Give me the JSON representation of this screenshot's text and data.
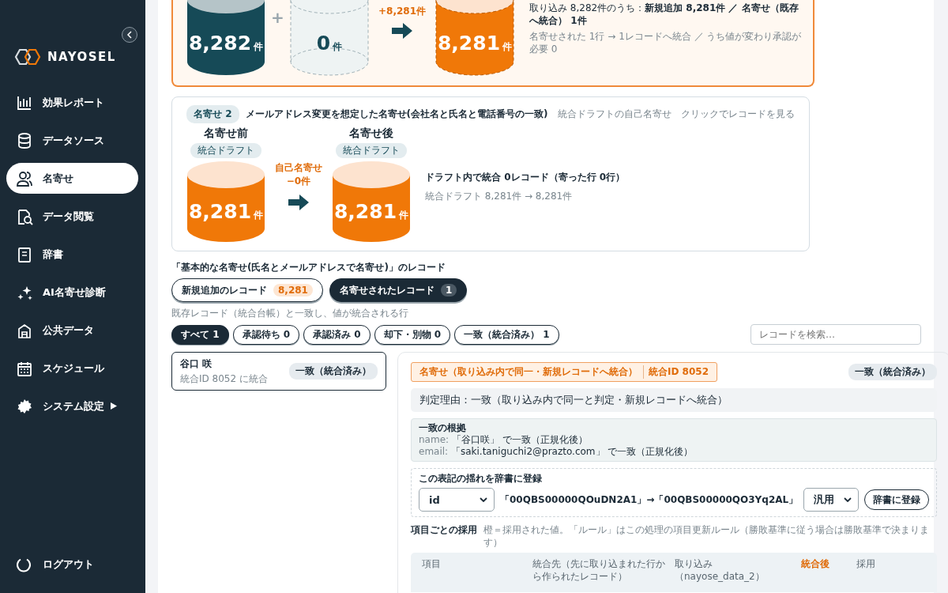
{
  "sidebar": {
    "logo": "NAYOSEL",
    "items": [
      {
        "label": "効果レポート",
        "selected": false
      },
      {
        "label": "データソース",
        "selected": false
      },
      {
        "label": "名寄せ",
        "selected": true
      },
      {
        "label": "データ閲覧",
        "selected": false
      },
      {
        "label": "辞書",
        "selected": false
      },
      {
        "label": "AI名寄せ診断",
        "selected": false
      },
      {
        "label": "公共データ",
        "selected": false
      },
      {
        "label": "スケジュール",
        "selected": false
      },
      {
        "label": "システム設定",
        "selected": false,
        "submenu": true
      }
    ],
    "logout": "ログアウト"
  },
  "stage1": {
    "cylinders": [
      {
        "kind": "solid",
        "count": "8,282",
        "unit": "件"
      },
      {
        "kind": "empty",
        "count": "0",
        "unit": "件"
      },
      {
        "kind": "result",
        "count": "8,281",
        "unit": "件"
      }
    ],
    "operator": "+",
    "arrow_label": "+8,281件",
    "summary": "取り込み 8,282件のうち：**新規追加 8,281件 ／ 名寄せ（既存へ統合） 1件**",
    "detail": "名寄せされた 1行 → 1レコードへ統合 ／ うち値が変わり承認が必要 0"
  },
  "stage2": {
    "badge": "名寄せ 2",
    "title": "メールアドレス変更を想定した名寄せ(会社名と氏名と電話番号の一致)",
    "notes": [
      "統合ドラフトの自己名寄せ",
      "クリックでレコードを見る"
    ],
    "before": {
      "heading": "名寄せ前",
      "tag": "統合ドラフト",
      "kind": "orange",
      "count": "8,281",
      "unit": "件"
    },
    "arrow_label": [
      "自己名寄せ",
      "−0件"
    ],
    "after": {
      "heading": "名寄せ後",
      "tag": "統合ドラフト",
      "kind": "orange",
      "count": "8,281",
      "unit": "件"
    },
    "summary": "ドラフト内で統合 0レコード（寄った行 0行）",
    "detail": "統合ドラフト 8,281件 → 8,281件"
  },
  "records": {
    "title": "「基本的な名寄せ(氏名とメールアドレスで名寄せ)」のレコード",
    "toggles": [
      {
        "label": "新規追加のレコード",
        "count": "8,281",
        "selected": false
      },
      {
        "label": "名寄せされたレコード",
        "count": "1",
        "selected": true
      }
    ],
    "caption": "既存レコード（統合台帳）と一致し、値が統合される行",
    "filters": [
      {
        "label": "すべて 1",
        "selected": true
      },
      {
        "label": "承認待ち 0",
        "selected": false
      },
      {
        "label": "承認済み 0",
        "selected": false
      },
      {
        "label": "却下・別物 0",
        "selected": false
      },
      {
        "label": "一致（統合済み） 1",
        "selected": false
      }
    ],
    "search": {
      "placeholder": "レコードを検索…"
    },
    "list": [
      {
        "name": "谷口 咲",
        "sub": "統合ID 8052 に統合",
        "status": "一致（統合済み）",
        "selected": true
      }
    ],
    "detail": {
      "tag": "名寄せ（取り込み内で同一・新規レコードへ統合）",
      "tag_id": "統合ID 8052",
      "status": "一致（統合済み）",
      "reason": "判定理由：一致（取り込み内で同一と判定・新規レコードへ統合）",
      "evidence": {
        "title": "一致の根拠",
        "rows": [
          {
            "key": "name:",
            "value": "「谷口咲」 で一致（正規化後）"
          },
          {
            "key": "email:",
            "value": "「saki.taniguchi2@prazto.com」 で一致（正規化後）"
          }
        ]
      },
      "dictionary": {
        "title": "この表記の揺れを辞書に登録",
        "field": "id",
        "mapping": "「00QBS00000QOuDN2A1」→「00QBS00000QO3Yq2AL」",
        "scope": "汎用",
        "button": "辞書に登録"
      },
      "adoption": {
        "title": "項目ごとの採用",
        "note": "橙＝採用された値。「ルール」はこの処理の項目更新ルール（勝敗基準に従う場合は勝敗基準で決まります）",
        "columns": [
          {
            "label": "項目",
            "kind": "plain"
          },
          {
            "label": "統合先（先に取り込まれた行から作られたレコード）",
            "kind": "plain"
          },
          {
            "label": "取り込み（nayose_data_2）",
            "kind": "plain"
          },
          {
            "label": "統合後",
            "kind": "accent"
          },
          {
            "label": "採用",
            "kind": "plain"
          }
        ]
      }
    }
  }
}
